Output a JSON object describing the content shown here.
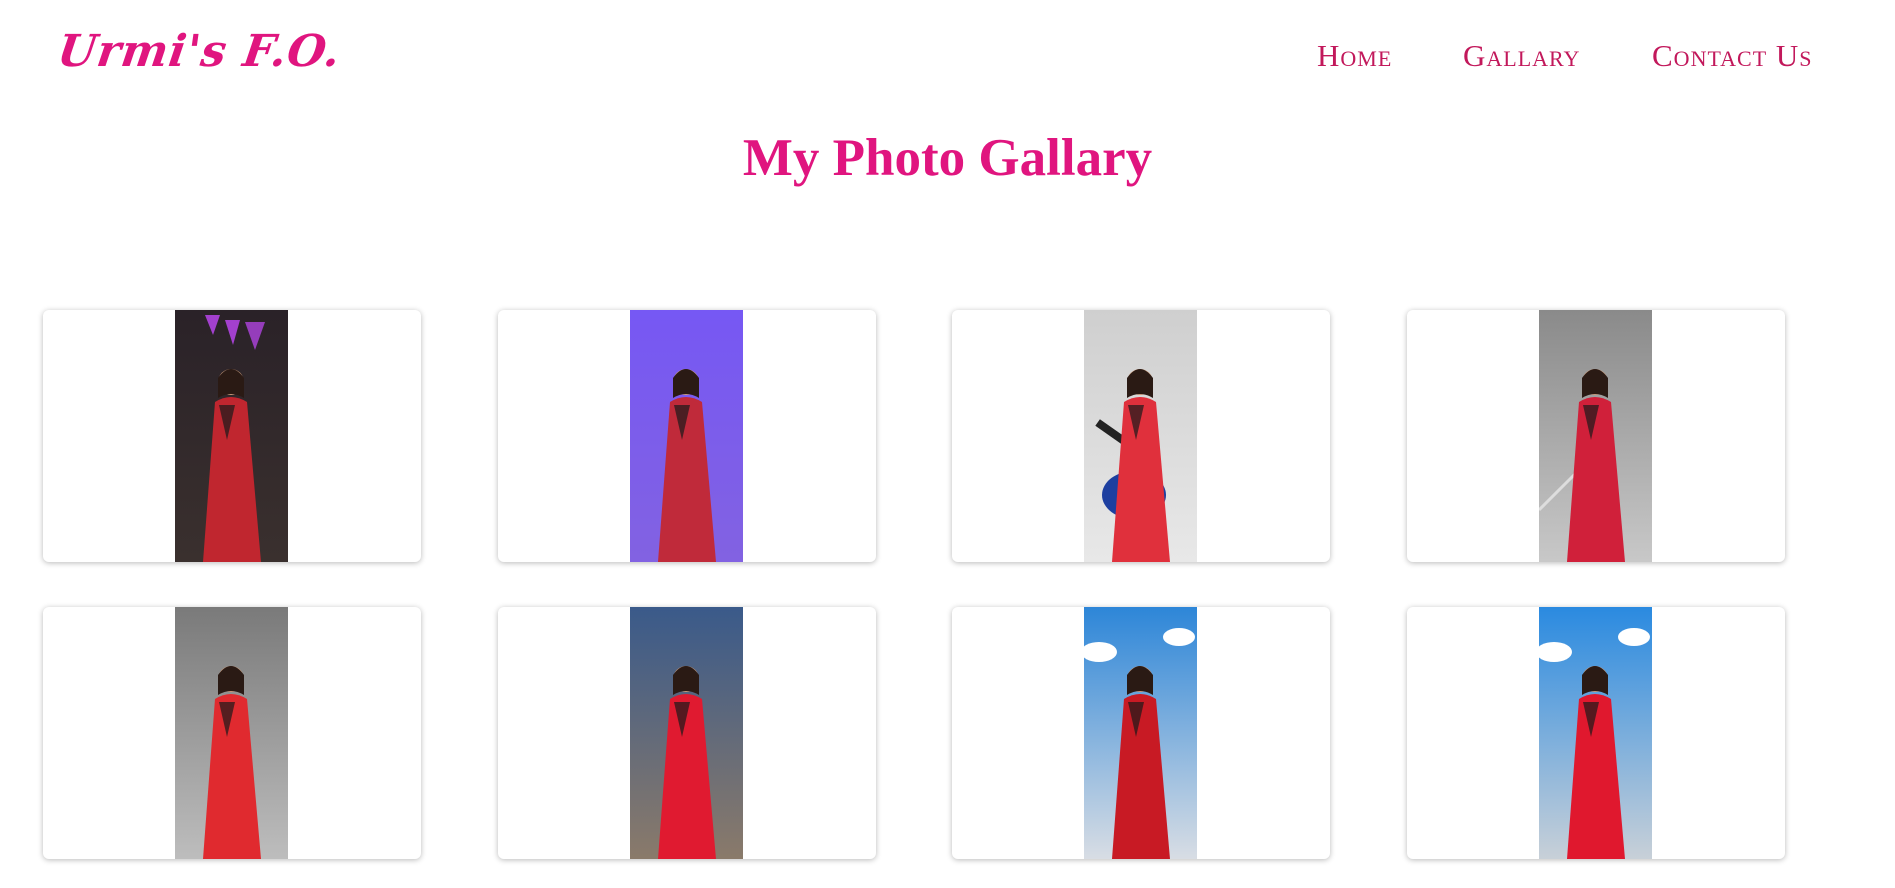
{
  "brand": {
    "logo_text": "Urmi's F.O."
  },
  "nav": {
    "items": [
      {
        "label": "Home"
      },
      {
        "label": "Gallary"
      },
      {
        "label": "Contact Us"
      }
    ]
  },
  "page": {
    "title": "My Photo Gallary"
  },
  "colors": {
    "accent": "#e0157f",
    "nav": "#c2185b"
  },
  "gallery": {
    "photos": [
      {
        "bg_top": "#2a2228",
        "bg_bottom": "#3a302e",
        "accent": "#b044e0",
        "saree": "#c0262f",
        "kind": "neon"
      },
      {
        "bg_top": "#6a4cf0",
        "bg_bottom": "#7a5ad8",
        "accent": "#9b7bff",
        "saree": "#c02a3a",
        "kind": "purple"
      },
      {
        "bg_top": "#cfcfcf",
        "bg_bottom": "#e8e8e8",
        "accent": "#1d3fa0",
        "saree": "#e0303c",
        "kind": "guitar"
      },
      {
        "bg_top": "#8a8a8a",
        "bg_bottom": "#c8c8c8",
        "accent": "#aaaaaa",
        "saree": "#d0203a",
        "kind": "stairs"
      },
      {
        "bg_top": "#7a7a7a",
        "bg_bottom": "#bdbdbd",
        "accent": "#999999",
        "saree": "#e02a2f",
        "kind": "grey"
      },
      {
        "bg_top": "#3a5a8a",
        "bg_bottom": "#8a7a6a",
        "accent": "#d8d0c0",
        "saree": "#e01a30",
        "kind": "evening"
      },
      {
        "bg_top": "#2d86d8",
        "bg_bottom": "#d8dde4",
        "accent": "#ffffff",
        "saree": "#c81a24",
        "kind": "sky"
      },
      {
        "bg_top": "#2a8ae0",
        "bg_bottom": "#c8d0d8",
        "accent": "#ffffff",
        "saree": "#e0182e",
        "kind": "sky2"
      }
    ]
  }
}
